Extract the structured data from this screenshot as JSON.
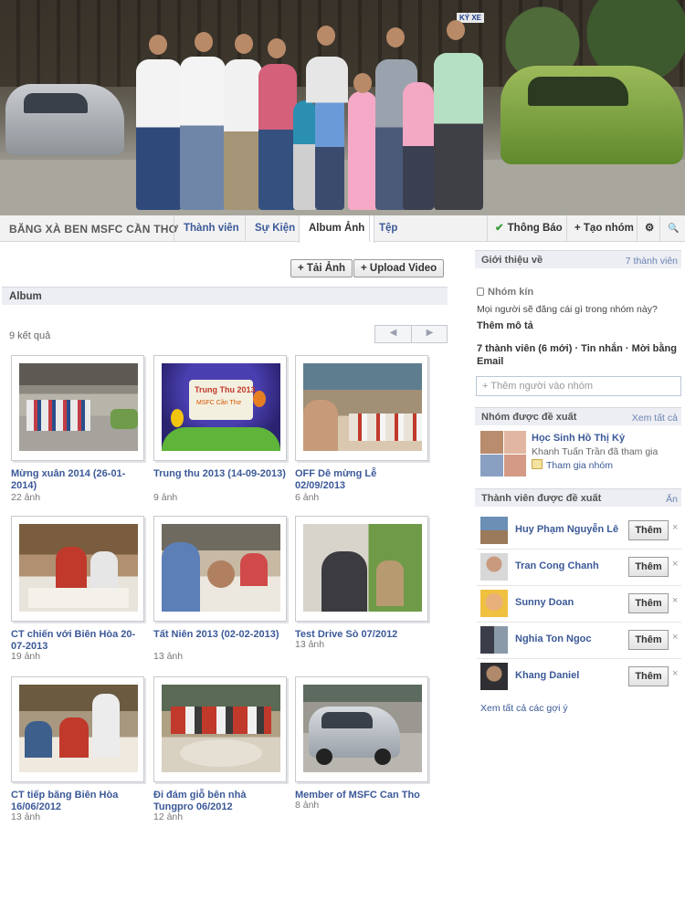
{
  "group": {
    "name": "BĂNG XÀ BEN MSFC CẦN THƠ",
    "tabs": [
      "Thành viên",
      "Sự Kiện",
      "Album Ảnh",
      "Tệp"
    ],
    "notify": "Thông Báo",
    "create_group": "+ Tạo nhóm",
    "gear": "⚙",
    "search": "🔍",
    "check": "✔"
  },
  "actions": {
    "upload_photo": "+ Tải Ảnh",
    "upload_video": "+ Upload Video"
  },
  "album_section": {
    "title": "Album",
    "results": "9 kết quả",
    "prev": "◀",
    "next": "▶"
  },
  "albums": [
    {
      "title": "Mừng xuân 2014 (26-01-2014)",
      "count": "22 ảnh"
    },
    {
      "title": "Trung thu 2013 (14-09-2013)",
      "count": "9 ảnh"
    },
    {
      "title": "OFF Dê mừng Lễ 02/09/2013",
      "count": "6 ảnh"
    },
    {
      "title": "CT chiến với Biên Hòa 20-07-2013",
      "count": "19 ảnh"
    },
    {
      "title": "Tất Niên 2013 (02-02-2013)",
      "count": "13 ảnh"
    },
    {
      "title": "Test Drive Sò 07/2012",
      "count": "13 ảnh"
    },
    {
      "title": "CT tiếp băng Biên Hòa 16/06/2012",
      "count": "13 ảnh"
    },
    {
      "title": "Đi đám giỗ bên nhà Tungpro 06/2012",
      "count": "12 ảnh"
    },
    {
      "title": "Member of MSFC Can Tho",
      "count": "8 ảnh"
    }
  ],
  "thumb_text": {
    "trung_thu_1": "Trung Thu 2013",
    "trung_thu_2": "MSFC Cần Thơ",
    "sign": "KÝ XE"
  },
  "sidebar": {
    "about_title": "Giới thiệu về",
    "members_link": "7 thành viên",
    "closed_group": "Nhóm kín",
    "question": "Mọi người sẽ đăng cái gì trong nhóm này?",
    "add_description": "Thêm mô tả",
    "member_summary": "7 thành viên (6 mới) · Tin nhắn · Mời bằng Email",
    "add_people_placeholder": "+ Thêm người vào nhóm",
    "suggested_groups_title": "Nhóm được đề xuất",
    "see_all": "Xem tất cả",
    "suggested_group": {
      "name": "Học Sinh Hồ Thị Kỷ",
      "joined": "Khanh Tuấn Trần đã tham gia",
      "join": "Tham gia nhóm"
    },
    "suggested_members_title": "Thành viên được đề xuất",
    "hide": "Ẩn",
    "members": [
      {
        "name": "Huy Phạm Nguyễn Lê",
        "add": "Thêm"
      },
      {
        "name": "Tran Cong Chanh",
        "add": "Thêm"
      },
      {
        "name": "Sunny Doan",
        "add": "Thêm"
      },
      {
        "name": "Nghia Ton Ngoc",
        "add": "Thêm"
      },
      {
        "name": "Khang Daniel",
        "add": "Thêm"
      }
    ],
    "close": "×",
    "see_all_suggestions": "Xem tất cả các gợi ý"
  }
}
